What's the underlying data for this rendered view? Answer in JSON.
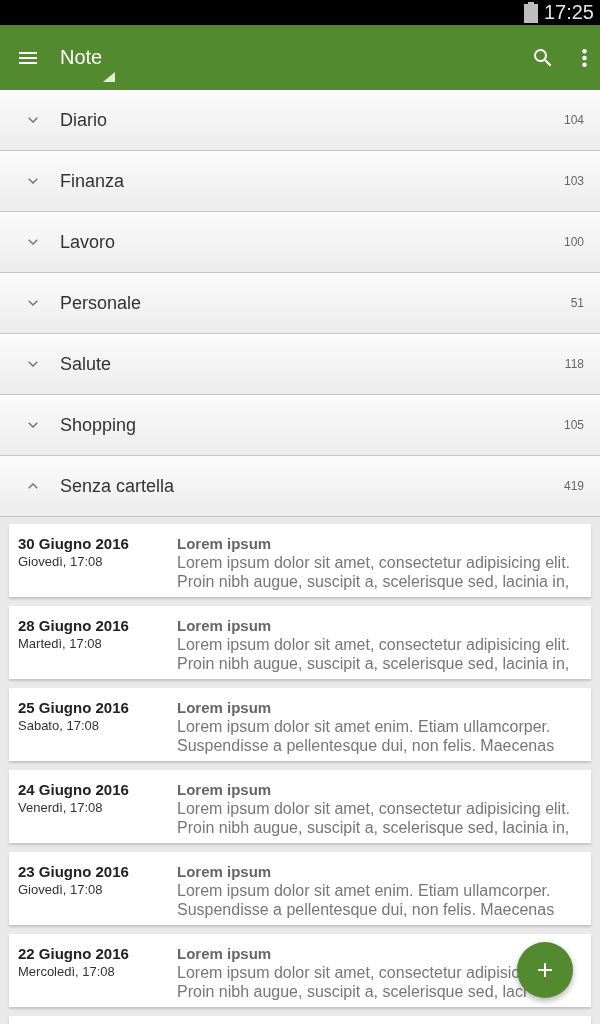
{
  "status_bar": {
    "time": "17:25"
  },
  "toolbar": {
    "title": "Note"
  },
  "folders": [
    {
      "name": "Diario",
      "count": "104",
      "expanded": false
    },
    {
      "name": "Finanza",
      "count": "103",
      "expanded": false
    },
    {
      "name": "Lavoro",
      "count": "100",
      "expanded": false
    },
    {
      "name": "Personale",
      "count": "51",
      "expanded": false
    },
    {
      "name": "Salute",
      "count": "118",
      "expanded": false
    },
    {
      "name": "Shopping",
      "count": "105",
      "expanded": false
    },
    {
      "name": "Senza cartella",
      "count": "419",
      "expanded": true,
      "notes": [
        {
          "date": "30 Giugno 2016",
          "day_time": "Giovedì, 17:08",
          "title": "Lorem ipsum",
          "preview": "Lorem ipsum dolor sit amet, consectetur adipisicing elit.\nProin nibh augue, suscipit a, scelerisque sed, lacinia in,"
        },
        {
          "date": "28 Giugno 2016",
          "day_time": "Martedì, 17:08",
          "title": "Lorem ipsum",
          "preview": "Lorem ipsum dolor sit amet, consectetur adipisicing elit.\nProin nibh augue, suscipit a, scelerisque sed, lacinia in,"
        },
        {
          "date": "25 Giugno 2016",
          "day_time": "Sabato, 17:08",
          "title": "Lorem ipsum",
          "preview": "Lorem ipsum dolor sit amet enim. Etiam ullamcorper.\nSuspendisse a pellentesque dui, non felis. Maecenas"
        },
        {
          "date": "24 Giugno 2016",
          "day_time": "Venerdì, 17:08",
          "title": "Lorem ipsum",
          "preview": "Lorem ipsum dolor sit amet, consectetur adipisicing elit.\nProin nibh augue, suscipit a, scelerisque sed, lacinia in,"
        },
        {
          "date": "23 Giugno 2016",
          "day_time": "Giovedì, 17:08",
          "title": "Lorem ipsum",
          "preview": "Lorem ipsum dolor sit amet enim. Etiam ullamcorper.\nSuspendisse a pellentesque dui, non felis. Maecenas"
        },
        {
          "date": "22 Giugno 2016",
          "day_time": "Mercoledì, 17:08",
          "title": "Lorem ipsum",
          "preview": "Lorem ipsum dolor sit amet, consectetur adipisic\nProin nibh augue, suscipit a, scelerisque sed, laci"
        }
      ]
    }
  ]
}
